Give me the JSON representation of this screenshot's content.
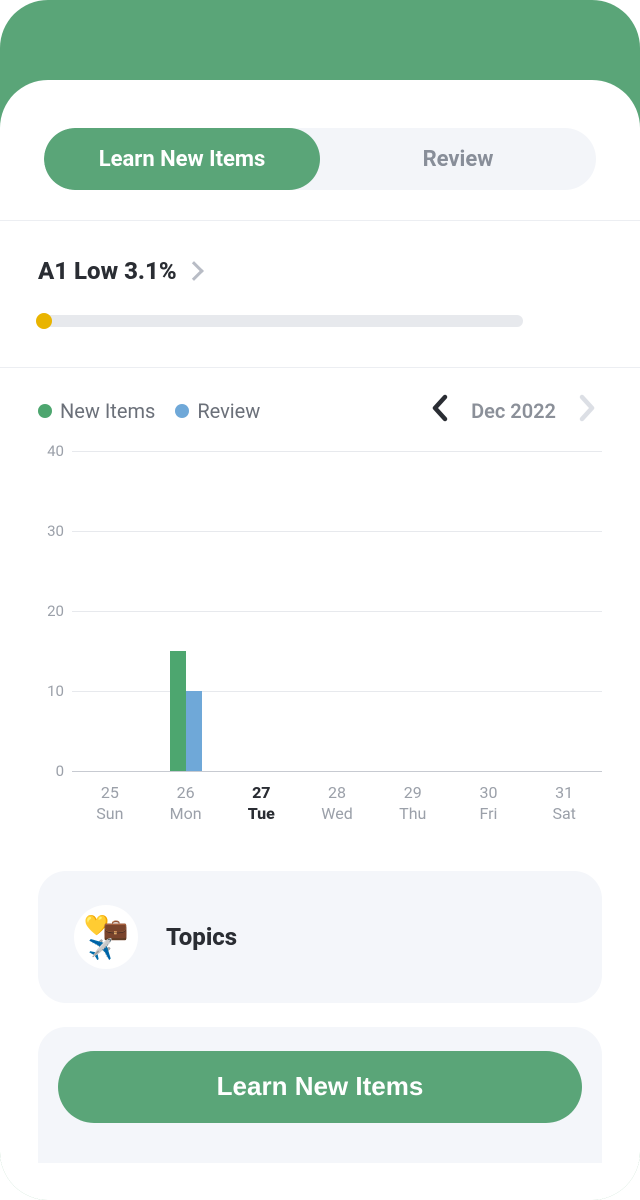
{
  "tabs": {
    "learn": "Learn New Items",
    "review": "Review",
    "active": "learn"
  },
  "level": {
    "label": "A1 Low 3.1%",
    "progress_percent": 3.1
  },
  "legend": {
    "new_items": "New Items",
    "review": "Review"
  },
  "month_nav": {
    "label": "Dec 2022",
    "prev_enabled": true,
    "next_enabled": false
  },
  "topics": {
    "title": "Topics"
  },
  "main_button": {
    "label": "Learn New Items"
  },
  "chart_data": {
    "type": "bar",
    "title": "",
    "xlabel": "",
    "ylabel": "",
    "ylim": [
      0,
      40
    ],
    "y_ticks": [
      0,
      10,
      20,
      30,
      40
    ],
    "categories": [
      {
        "day": "25",
        "dow": "Sun",
        "active": false
      },
      {
        "day": "26",
        "dow": "Mon",
        "active": false
      },
      {
        "day": "27",
        "dow": "Tue",
        "active": true
      },
      {
        "day": "28",
        "dow": "Wed",
        "active": false
      },
      {
        "day": "29",
        "dow": "Thu",
        "active": false
      },
      {
        "day": "30",
        "dow": "Fri",
        "active": false
      },
      {
        "day": "31",
        "dow": "Sat",
        "active": false
      }
    ],
    "series": [
      {
        "name": "New Items",
        "color": "#4da66f",
        "values": [
          0,
          15,
          0,
          0,
          0,
          0,
          0
        ]
      },
      {
        "name": "Review",
        "color": "#6fa8d8",
        "values": [
          0,
          10,
          0,
          0,
          0,
          0,
          0
        ]
      }
    ]
  }
}
